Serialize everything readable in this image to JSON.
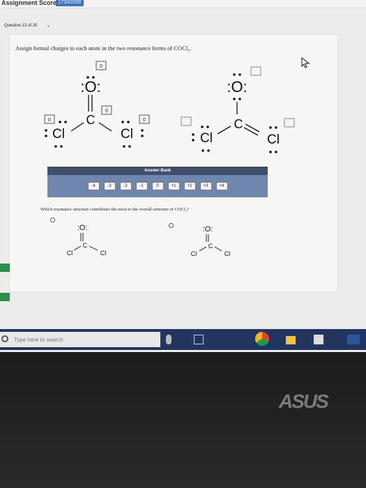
{
  "header": {
    "assignment_score_label": "Assignment Score:",
    "assignment_score_value": "1733/2000"
  },
  "question_nav": {
    "label": "Question 13 of 20",
    "next_icon": "chevron-right-icon"
  },
  "prompt": "Assign formal charges to each atom in the two resonance forms of COCl₂.",
  "structures": {
    "atom_O": ":O:",
    "atom_C": "C",
    "atom_Cl": "Cl",
    "box_value": "0"
  },
  "answer_bank": {
    "title": "Answer Bank",
    "chips": [
      "-4",
      "-3",
      "-2",
      "-1",
      "0",
      "+1",
      "+2",
      "+3",
      "+4"
    ]
  },
  "question2": "Which resonance structure contributes the most to the overall structure of COCl₂?",
  "search": {
    "placeholder": "Type here to search"
  },
  "brand": "ASUS"
}
